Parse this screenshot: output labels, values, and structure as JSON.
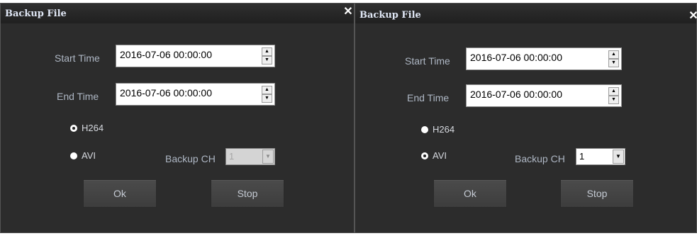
{
  "dialogs": [
    {
      "title": "Backup File",
      "close_icon": "close-icon",
      "start_time_label": "Start Time",
      "start_time_value": "2016-07-06 00:00:00",
      "end_time_label": "End Time",
      "end_time_value": "2016-07-06 00:00:00",
      "radio_h264_label": "H264",
      "radio_avi_label": "AVI",
      "selected_format": "H264",
      "backup_ch_label": "Backup CH",
      "backup_ch_value": "1",
      "backup_ch_enabled": false,
      "ok_label": "Ok",
      "stop_label": "Stop"
    },
    {
      "title": "Backup File",
      "close_icon": "close-icon",
      "start_time_label": "Start Time",
      "start_time_value": "2016-07-06 00:00:00",
      "end_time_label": "End Time",
      "end_time_value": "2016-07-06 00:00:00",
      "radio_h264_label": "H264",
      "radio_avi_label": "AVI",
      "selected_format": "AVI",
      "backup_ch_label": "Backup CH",
      "backup_ch_value": "1",
      "backup_ch_enabled": true,
      "ok_label": "Ok",
      "stop_label": "Stop"
    }
  ],
  "colors": {
    "dialog_bg": "#2c2c2c",
    "title_text": "#dfe6f4",
    "label_text": "#aeb7c4",
    "button_bg": "#454545"
  }
}
